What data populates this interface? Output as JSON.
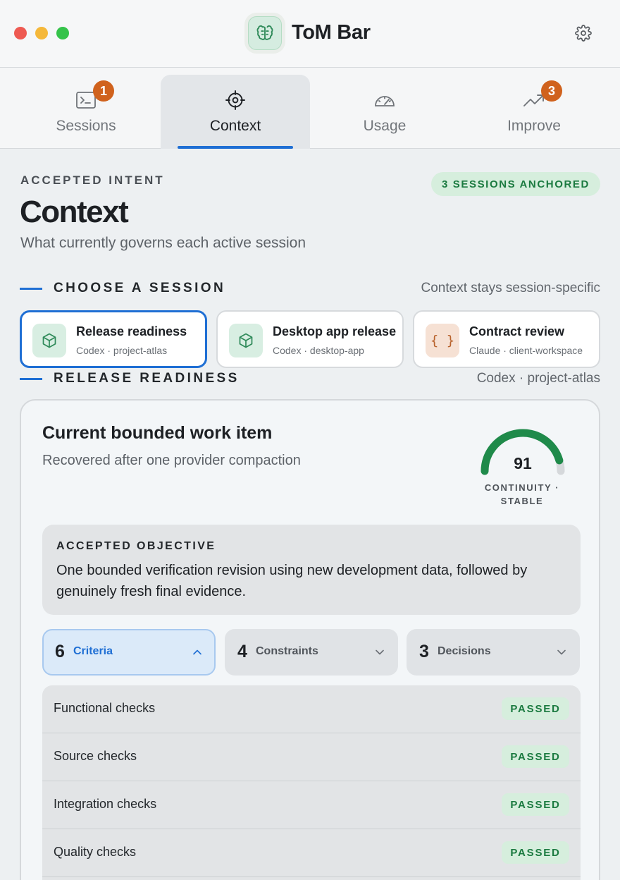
{
  "app": {
    "title": "ToM Bar"
  },
  "tabs": [
    {
      "label": "Sessions",
      "badge": "1"
    },
    {
      "label": "Context",
      "badge": ""
    },
    {
      "label": "Usage",
      "badge": ""
    },
    {
      "label": "Improve",
      "badge": "3"
    }
  ],
  "header": {
    "eyebrow": "ACCEPTED INTENT",
    "anchored_badge": "3 SESSIONS ANCHORED",
    "title": "Context",
    "subtitle": "What currently governs each active session"
  },
  "choose_section": {
    "title": "CHOOSE A SESSION",
    "note": "Context stays session-specific"
  },
  "sessions": [
    {
      "name": "Release readiness",
      "meta": "Codex · project-atlas",
      "icon": "cube-icon"
    },
    {
      "name": "Desktop app release",
      "meta": "Codex · desktop-app",
      "icon": "cube-icon"
    },
    {
      "name": "Contract review",
      "meta": "Claude · client-workspace",
      "icon": "braces-icon"
    }
  ],
  "detail_section": {
    "title": "RELEASE READINESS",
    "note": "Codex · project-atlas"
  },
  "work_item": {
    "title": "Current bounded work item",
    "subtitle": "Recovered after one provider compaction",
    "continuity_score": "91",
    "continuity_fraction": 0.91,
    "continuity_label": "CONTINUITY · STABLE"
  },
  "objective": {
    "label": "ACCEPTED OBJECTIVE",
    "text": "One bounded verification revision using new development data, followed by genuinely fresh final evidence."
  },
  "pills": [
    {
      "count": "6",
      "label": "Criteria",
      "expanded": true
    },
    {
      "count": "4",
      "label": "Constraints",
      "expanded": false
    },
    {
      "count": "3",
      "label": "Decisions",
      "expanded": false
    }
  ],
  "checks": [
    {
      "label": "Functional checks",
      "status": "PASSED"
    },
    {
      "label": "Source checks",
      "status": "PASSED"
    },
    {
      "label": "Integration checks",
      "status": "PASSED"
    },
    {
      "label": "Quality checks",
      "status": "PASSED"
    }
  ],
  "colors": {
    "accent": "#1f6fd4",
    "badge": "#d0621d",
    "success": "#1b7a40",
    "success_bg": "#d6eedd"
  }
}
